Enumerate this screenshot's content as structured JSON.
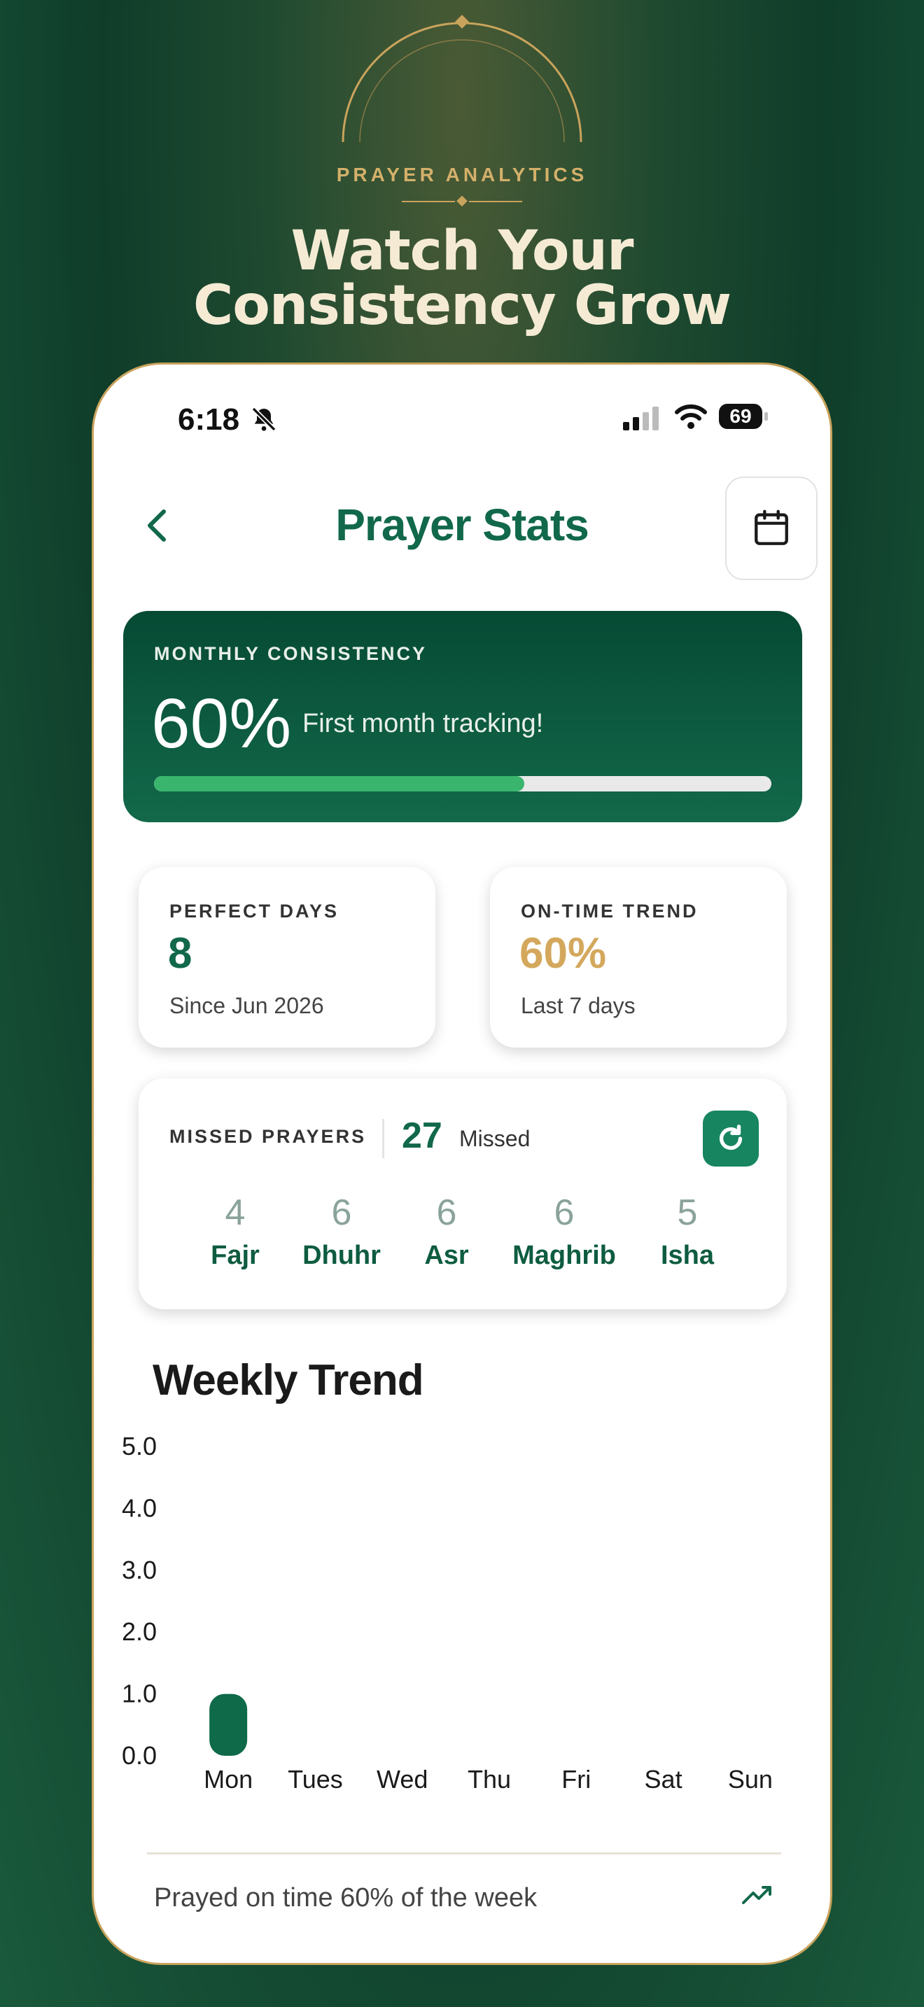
{
  "hero": {
    "label": "PRAYER ANALYTICS",
    "title_line1": "Watch Your",
    "title_line2": "Consistency Grow"
  },
  "status_bar": {
    "time": "6:18",
    "battery": "69"
  },
  "header": {
    "title": "Prayer Stats"
  },
  "monthly": {
    "label": "MONTHLY CONSISTENCY",
    "percent": "60%",
    "message": "First month tracking!",
    "progress_fraction": 0.6
  },
  "perfect_days": {
    "label": "PERFECT DAYS",
    "value": "8",
    "sub": "Since Jun 2026"
  },
  "on_time": {
    "label": "ON-TIME TREND",
    "value": "60%",
    "sub": "Last 7 days"
  },
  "missed": {
    "label": "MISSED PRAYERS",
    "count": "27",
    "word": "Missed",
    "prayers": [
      {
        "count": "4",
        "name": "Fajr"
      },
      {
        "count": "6",
        "name": "Dhuhr"
      },
      {
        "count": "6",
        "name": "Asr"
      },
      {
        "count": "6",
        "name": "Maghrib"
      },
      {
        "count": "5",
        "name": "Isha"
      }
    ]
  },
  "weekly": {
    "title": "Weekly Trend",
    "summary": "Prayed on time 60% of the week"
  },
  "colors": {
    "primary": "#11684a",
    "accent_gold": "#d4b06a",
    "progress": "#3ab56e"
  },
  "chart_data": {
    "type": "bar",
    "categories": [
      "Mon",
      "Tues",
      "Wed",
      "Thu",
      "Fri",
      "Sat",
      "Sun"
    ],
    "values": [
      1,
      0,
      0,
      0,
      0,
      0,
      0
    ],
    "ylim": [
      0,
      5
    ],
    "yticks": [
      "0.0",
      "1.0",
      "2.0",
      "3.0",
      "4.0",
      "5.0"
    ],
    "grid": false,
    "bar_color": "#0e6a48"
  }
}
